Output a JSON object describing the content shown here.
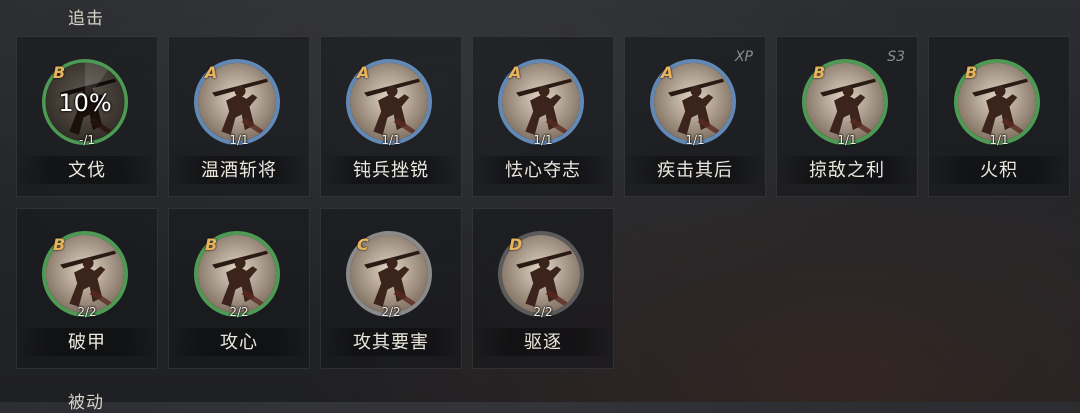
{
  "sections": {
    "top_label": "追击",
    "bottom_label": "被动"
  },
  "colors": {
    "grade": "#e8b35a",
    "ring_green": "#4e9a55",
    "ring_blue": "#6289b6",
    "ring_gray": "#8a8a8a",
    "ring_dark": "#5b5b5b"
  },
  "skills": [
    {
      "name": "文伐",
      "grade": "B",
      "uses": "-/1",
      "ring": "green",
      "cooldown": "10%",
      "cooldown_progress": 0.1,
      "tag": ""
    },
    {
      "name": "温酒斩将",
      "grade": "A",
      "uses": "1/1",
      "ring": "blue",
      "tag": ""
    },
    {
      "name": "钝兵挫锐",
      "grade": "A",
      "uses": "1/1",
      "ring": "blue",
      "tag": ""
    },
    {
      "name": "怯心夺志",
      "grade": "A",
      "uses": "1/1",
      "ring": "blue",
      "tag": ""
    },
    {
      "name": "疾击其后",
      "grade": "A",
      "uses": "1/1",
      "ring": "blue",
      "tag": "XP"
    },
    {
      "name": "掠敌之利",
      "grade": "B",
      "uses": "1/1",
      "ring": "green",
      "tag": "S3"
    },
    {
      "name": "火积",
      "grade": "B",
      "uses": "1/1",
      "ring": "green",
      "tag": ""
    },
    {
      "name": "破甲",
      "grade": "B",
      "uses": "2/2",
      "ring": "green",
      "tag": ""
    },
    {
      "name": "攻心",
      "grade": "B",
      "uses": "2/2",
      "ring": "green",
      "tag": ""
    },
    {
      "name": "攻其要害",
      "grade": "C",
      "uses": "2/2",
      "ring": "gray",
      "tag": ""
    },
    {
      "name": "驱逐",
      "grade": "D",
      "uses": "2/2",
      "ring": "dark",
      "tag": ""
    }
  ]
}
